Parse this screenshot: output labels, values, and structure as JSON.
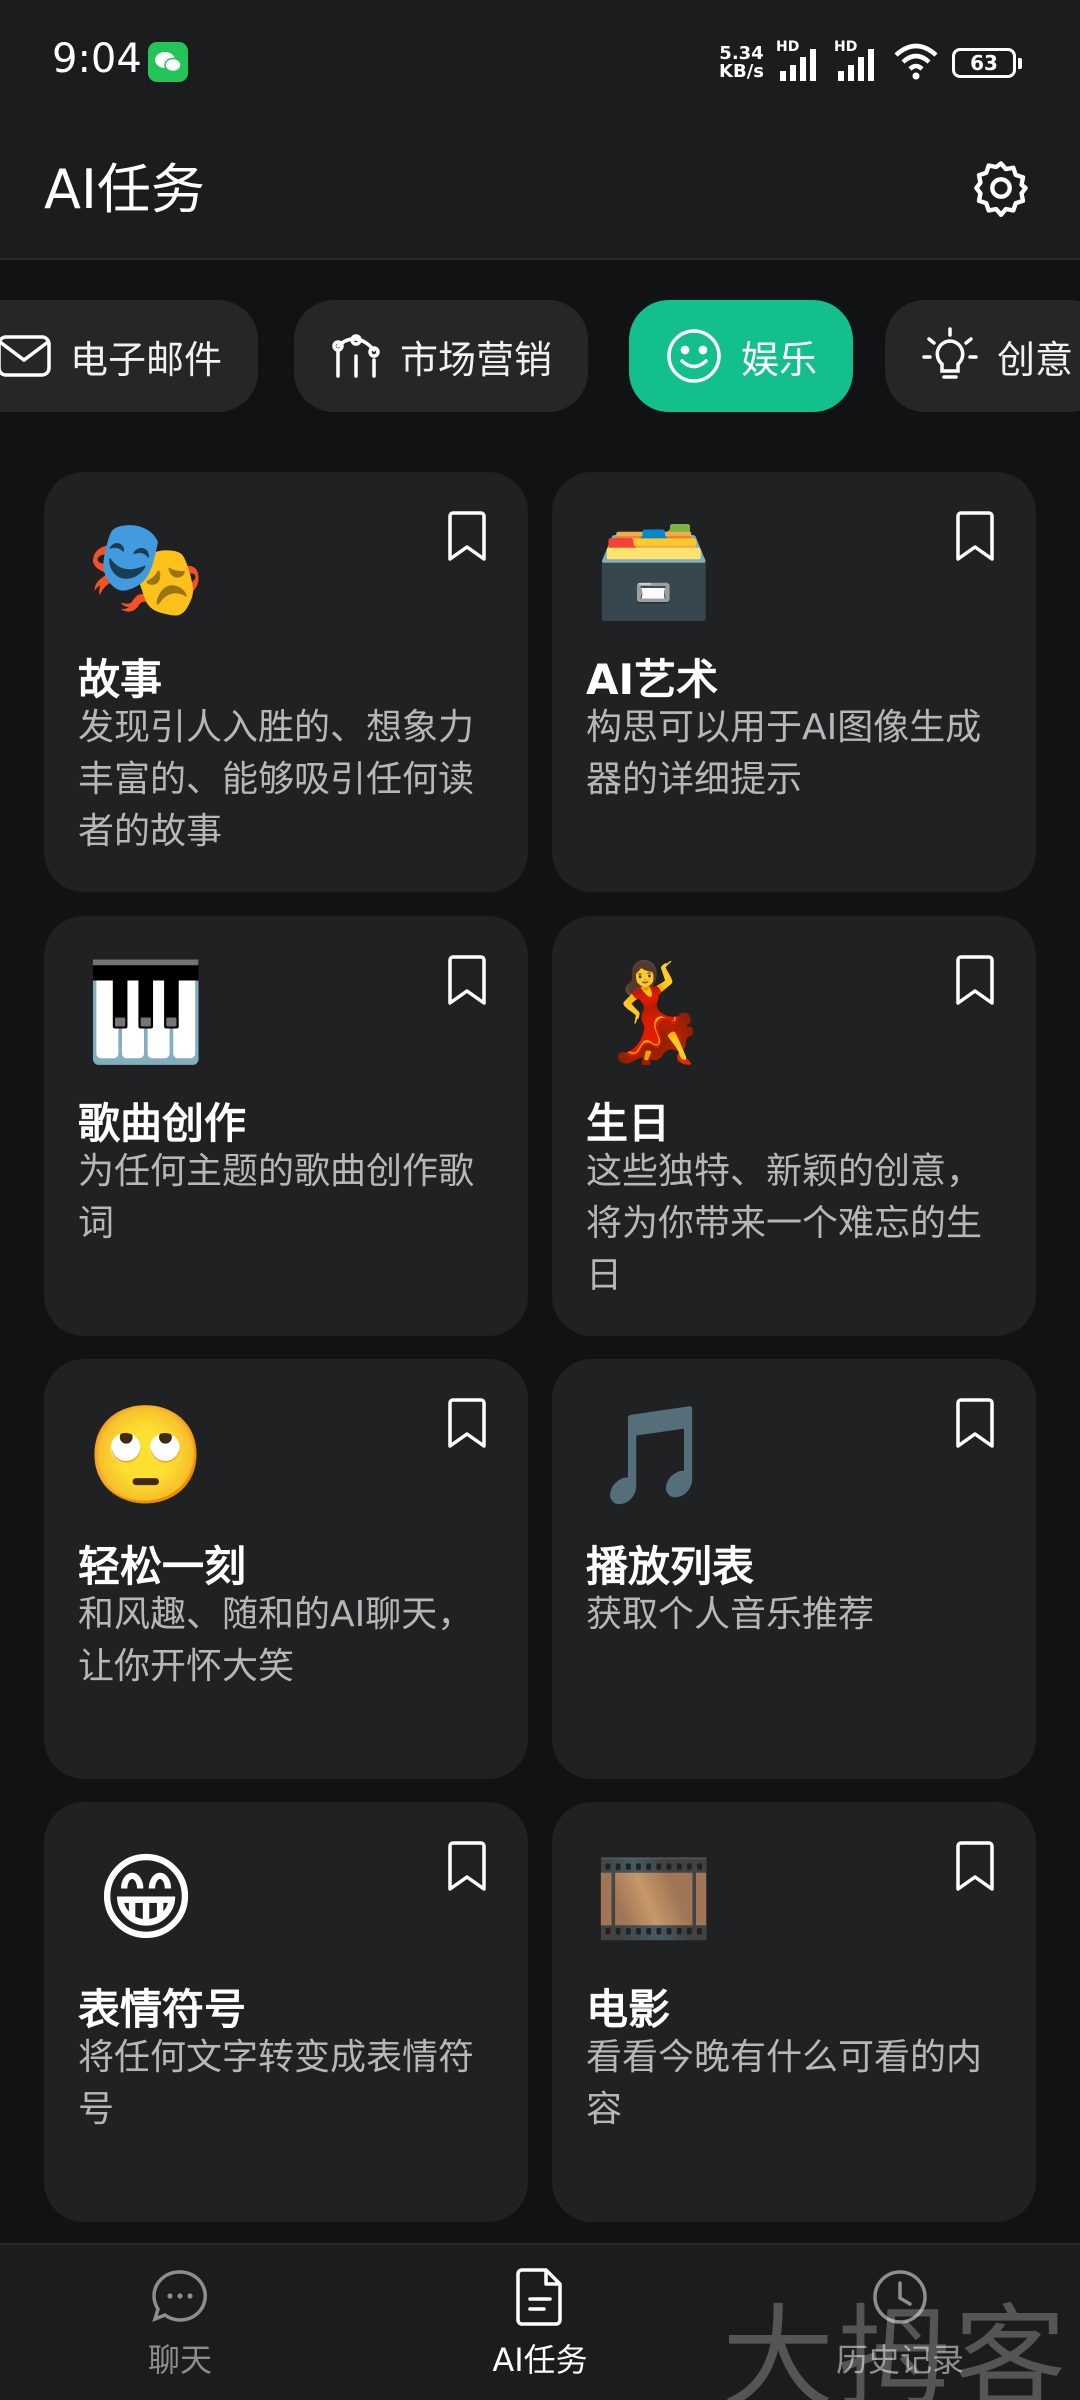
{
  "status_bar": {
    "time": "9:04",
    "speed_value": "5.34",
    "speed_unit": "KB/s",
    "network_badge_1": "HD",
    "network_badge_2": "HD",
    "battery": "63",
    "icons": [
      "wechat-icon",
      "signal-icon",
      "signal-icon",
      "wifi-icon",
      "battery-icon"
    ]
  },
  "header": {
    "title": "AI任务",
    "settings_icon": "gear-icon"
  },
  "categories": [
    {
      "label": "电子邮件",
      "icon": "mail-icon",
      "active": false
    },
    {
      "label": "市场营销",
      "icon": "marketing-icon",
      "active": false
    },
    {
      "label": "娱乐",
      "icon": "smile-icon",
      "active": true
    },
    {
      "label": "创意",
      "icon": "lightbulb-icon",
      "active": false
    }
  ],
  "cards": [
    {
      "emoji": "🎭",
      "title": "故事",
      "description": "发现引人入胜的、想象力丰富的、能够吸引任何读者的故事"
    },
    {
      "emoji": "🗃️",
      "title": "AI艺术",
      "description": "构思可以用于AI图像生成器的详细提示"
    },
    {
      "emoji": "🎹",
      "title": "歌曲创作",
      "description": "为任何主题的歌曲创作歌词"
    },
    {
      "emoji": "💃",
      "title": "生日",
      "description": "这些独特、新颖的创意，将为你带来一个难忘的生日"
    },
    {
      "emoji": "🙄",
      "title": "轻松一刻",
      "description": "和风趣、随和的AI聊天，让你开怀大笑"
    },
    {
      "emoji": "🎵",
      "title": "播放列表",
      "description": "获取个人音乐推荐"
    },
    {
      "emoji": "😁",
      "title": "表情符号",
      "description": "将任何文字转变成表情符号"
    },
    {
      "emoji": "🎞️",
      "title": "电影",
      "description": "看看今晚有什么可看的内容"
    }
  ],
  "bottom_nav": [
    {
      "label": "聊天",
      "icon": "chat-bubble-icon",
      "active": false
    },
    {
      "label": "AI任务",
      "icon": "document-icon",
      "active": true
    },
    {
      "label": "历史记录",
      "icon": "history-icon",
      "active": false
    }
  ],
  "watermark": "大拇客",
  "colors": {
    "background": "#111213",
    "card": "#202123",
    "chip": "#252628",
    "accent": "#12bf8d",
    "secondary_text": "#b6b7b9"
  }
}
